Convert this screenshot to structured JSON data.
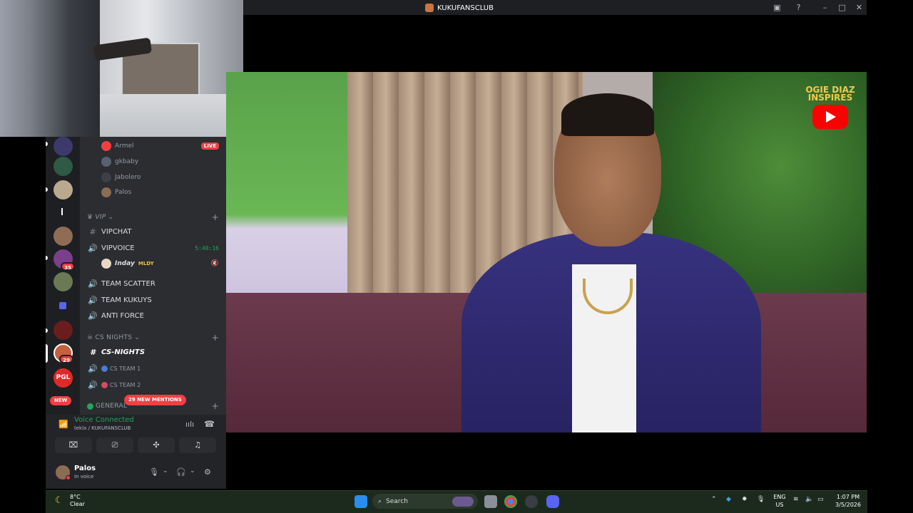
{
  "window": {
    "title": "KUKUFANSCLUB"
  },
  "video": {
    "brand_text": "OGIE DIAZ\nINSPIRES",
    "brand_line1": "OGIE DIAZ",
    "brand_line2": "INSPIRES"
  },
  "channels": {
    "voice_users_top": [
      {
        "name": "Armel",
        "live": "LIVE"
      },
      {
        "name": "gkbaby"
      },
      {
        "name": "Jabolero"
      },
      {
        "name": "Palos"
      }
    ],
    "vip_category": "VIP",
    "vipchat": "VIPCHAT",
    "vipvoice": "VIPVOICE",
    "vipvoice_timer": "5:40:16",
    "vipvoice_user": "Inday",
    "vipvoice_user_tag": "MLDY",
    "team_scatter": "TEAM SCATTER",
    "team_kukuys": "TEAM KUKUYS",
    "anti_force": "ANTI FORCE",
    "cs_category": "CS NIGHTS",
    "cs_nights": "CS-NIGHTS",
    "cs_team1": "CS TEAM 1",
    "cs_team2": "CS TEAM 2",
    "general": "GENERAL",
    "new_mentions": "29 NEW MENTIONS"
  },
  "rail": {
    "badge_35": "35",
    "badge_29": "29",
    "new_label": "NEW",
    "pgl_label": "PGL"
  },
  "voice": {
    "status": "Voice Connected",
    "channel": "tekla / KUKUFANSCLUB"
  },
  "user": {
    "name": "Palos",
    "status": "In voice"
  },
  "taskbar": {
    "temp": "8°C",
    "weather": "Clear",
    "search_placeholder": "Search",
    "lang_line1": "ENG",
    "lang_line2": "US",
    "time": "1:07 PM",
    "date": "3/5/2026"
  },
  "colors": {
    "accent_green": "#23a55a",
    "danger_red": "#f23f43",
    "sidebar_bg": "#2b2d31",
    "rail_bg": "#1e1f22"
  }
}
